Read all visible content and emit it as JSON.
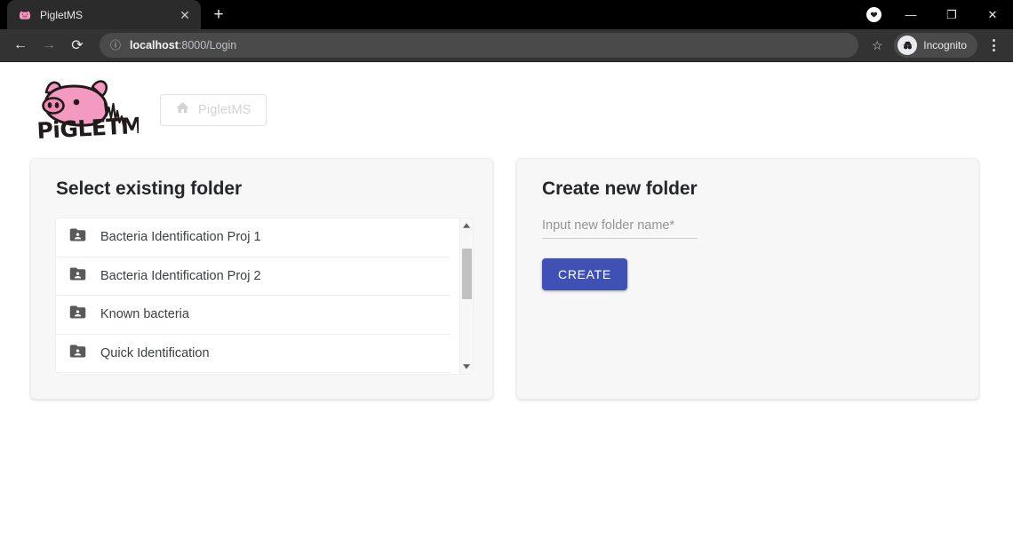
{
  "browser": {
    "tab": {
      "title": "PigletMS",
      "favicon_icon": "piglet-favicon",
      "close_icon": "✕"
    },
    "new_tab_icon": "+",
    "window_controls": {
      "badge_icon": "heart-badge-icon",
      "minimize": "—",
      "maximize": "❐",
      "close": "✕"
    },
    "toolbar": {
      "back_icon": "←",
      "forward_icon": "→",
      "reload_icon": "⟳",
      "info_icon": "ⓘ",
      "url_host": "localhost",
      "url_path": ":8000/Login",
      "star_icon": "☆",
      "incognito_label": "Incognito",
      "incognito_icon": "incognito-avatar-icon",
      "menu_icon": "kebab-menu-icon"
    }
  },
  "app": {
    "logo_alt": "PigletMS",
    "logo_wordmark": "PiGLETMS",
    "home_button": {
      "label": "PigletMS",
      "icon": "home-icon"
    }
  },
  "select_folder_card": {
    "title": "Select existing folder",
    "folder_icon": "folder-shared-icon",
    "folders": [
      {
        "name": "Bacteria Identification Proj 1"
      },
      {
        "name": "Bacteria Identification Proj 2"
      },
      {
        "name": "Known bacteria"
      },
      {
        "name": "Quick Identification"
      }
    ],
    "scrollbar": {
      "up_icon": "▲",
      "down_icon": "▼"
    }
  },
  "create_folder_card": {
    "title": "Create new folder",
    "input": {
      "value": "",
      "placeholder": "Input new folder name",
      "required_marker": "*"
    },
    "create_button_label": "CREATE"
  },
  "colors": {
    "accent": "#3f51b5",
    "card_bg": "#f7f7f7",
    "page_bg": "#ffffff",
    "logo_pink": "#f49ac1",
    "text_dark": "#25272b"
  }
}
